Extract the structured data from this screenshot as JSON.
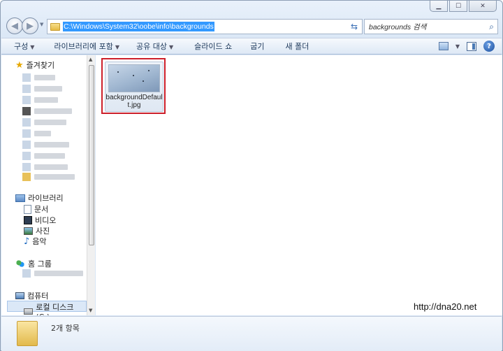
{
  "address": {
    "path": "C:\\Windows\\System32\\oobe\\info\\backgrounds"
  },
  "search": {
    "placeholder": "backgrounds 검색"
  },
  "toolbar": {
    "items": [
      "구성",
      "라이브러리에 포함",
      "공유 대상",
      "슬라이드 쇼",
      "굽기",
      "새 폴더"
    ]
  },
  "nav": {
    "favorites": "즐겨찾기",
    "libraries": "라이브러리",
    "library_items": [
      "문서",
      "비디오",
      "사진",
      "음악"
    ],
    "homegroup": "홈 그룹",
    "computer": "컴퓨터",
    "local_disk": "로컬 디스크 (C:)"
  },
  "file": {
    "name": "backgroundDefault.jpg"
  },
  "status": {
    "item_count": "2개 항목"
  },
  "watermark": "http://dna20.net",
  "icons": {
    "favorites": "star-icon",
    "library": "library-icon",
    "document": "document-icon",
    "video": "video-icon",
    "picture": "picture-icon",
    "music": "music-icon",
    "homegroup": "homegroup-icon",
    "computer": "computer-icon",
    "disk": "disk-icon",
    "search": "search-icon",
    "refresh": "refresh-icon",
    "help": "help-icon"
  },
  "colors": {
    "selection": "#3399ff",
    "highlight_border": "#cc1f2a"
  }
}
